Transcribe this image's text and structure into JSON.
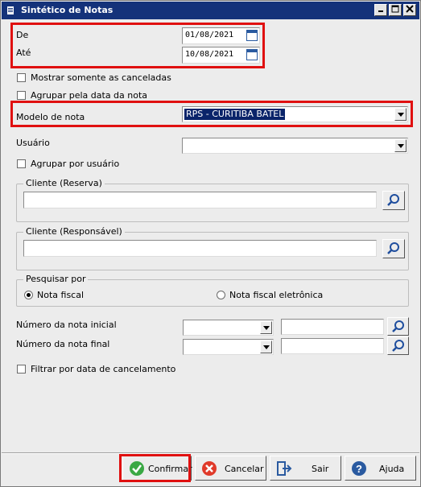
{
  "window": {
    "title": "Sintético de Notas"
  },
  "form": {
    "de_label": "De",
    "de_value": "01/08/2021",
    "ate_label": "Até",
    "ate_value": "10/08/2021",
    "mostrar_canceladas": "Mostrar somente as canceladas",
    "agrupar_data": "Agrupar pela data da nota",
    "modelo_label": "Modelo de nota",
    "modelo_value": "RPS - CURITIBA BATEL",
    "usuario_label": "Usuário",
    "usuario_value": "",
    "agrupar_usuario": "Agrupar por usuário",
    "cliente_reserva": "Cliente (Reserva)",
    "cliente_responsavel": "Cliente (Responsável)",
    "pesquisar_por": "Pesquisar por",
    "radio_nota_fiscal": "Nota fiscal",
    "radio_nota_eletronica": "Nota fiscal eletrônica",
    "numero_inicial_label": "Número da nota inicial",
    "numero_final_label": "Número da nota final",
    "filtrar_cancelamento": "Filtrar por data de cancelamento"
  },
  "buttons": {
    "confirmar": "Confirmar",
    "cancelar": "Cancelar",
    "sair": "Sair",
    "ajuda": "Ajuda"
  },
  "colors": {
    "highlight": "#e01010",
    "title_bar": "#14327a"
  }
}
